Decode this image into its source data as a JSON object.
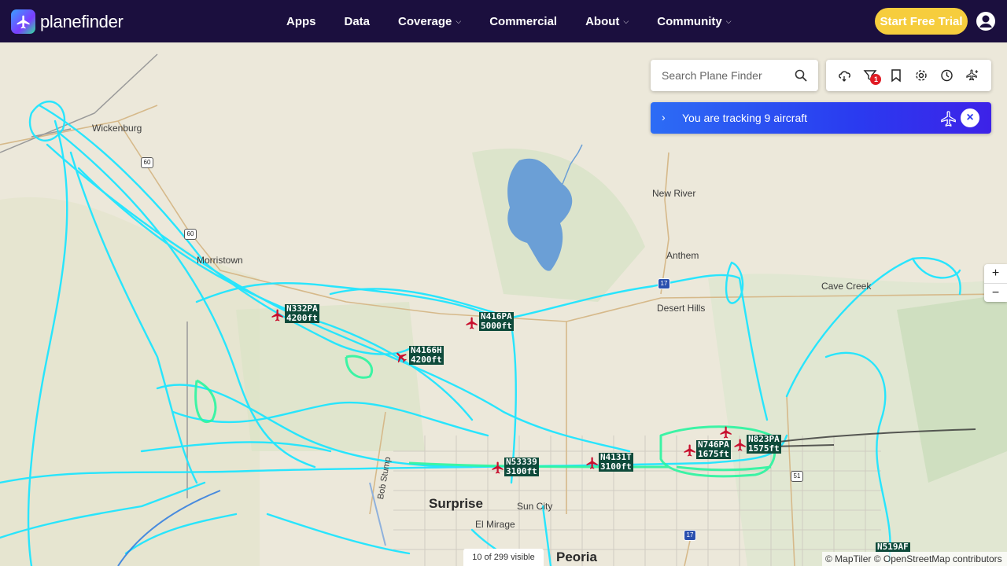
{
  "header": {
    "brand_light": "plane",
    "brand_bold": "finder",
    "nav": [
      {
        "label": "Apps"
      },
      {
        "label": "Data"
      },
      {
        "label": "Coverage",
        "dropdown": true
      },
      {
        "label": "Commercial"
      },
      {
        "label": "About",
        "dropdown": true
      },
      {
        "label": "Community",
        "dropdown": true
      }
    ],
    "cta_label": "Start Free Trial",
    "cta_color": "#f6cd3d"
  },
  "search": {
    "placeholder": "Search Plane Finder"
  },
  "toolbar": {
    "tools": [
      "weather-icon",
      "filter-icon",
      "bookmark-icon",
      "settings-icon",
      "history-icon",
      "add-aircraft-icon"
    ],
    "filter_badge": "1"
  },
  "tracking": {
    "text": "You are tracking 9 aircraft"
  },
  "zoom": {
    "in": "+",
    "out": "−"
  },
  "map": {
    "places": [
      {
        "name": "Wickenburg"
      },
      {
        "name": "Morristown"
      },
      {
        "name": "New River"
      },
      {
        "name": "Anthem"
      },
      {
        "name": "Desert Hills"
      },
      {
        "name": "Cave Creek"
      },
      {
        "name": "Surprise"
      },
      {
        "name": "Sun City"
      },
      {
        "name": "El Mirage"
      },
      {
        "name": "Peoria"
      },
      {
        "name": "Bob Stump"
      }
    ],
    "shields": [
      "60",
      "60",
      "17",
      "17",
      "51"
    ],
    "aircraft": [
      {
        "callsign": "N332PA",
        "alt": "4200ft"
      },
      {
        "callsign": "N416PA",
        "alt": "5000ft"
      },
      {
        "callsign": "N4166H",
        "alt": "4200ft"
      },
      {
        "callsign": "N53339",
        "alt": "3100ft"
      },
      {
        "callsign": "N4131T",
        "alt": "3100ft"
      },
      {
        "callsign": "N746PA",
        "alt": "1675ft"
      },
      {
        "callsign": "N823PA",
        "alt": "1575ft"
      },
      {
        "callsign": "N519AF",
        "alt": ""
      }
    ],
    "track_color": "#1ee5ff",
    "track_color_low": "#2af5a0",
    "aircraft_color": "#c8102e"
  },
  "status": {
    "visible": "10 of 299 visible",
    "attribution": "© MapTiler © OpenStreetMap contributors"
  }
}
